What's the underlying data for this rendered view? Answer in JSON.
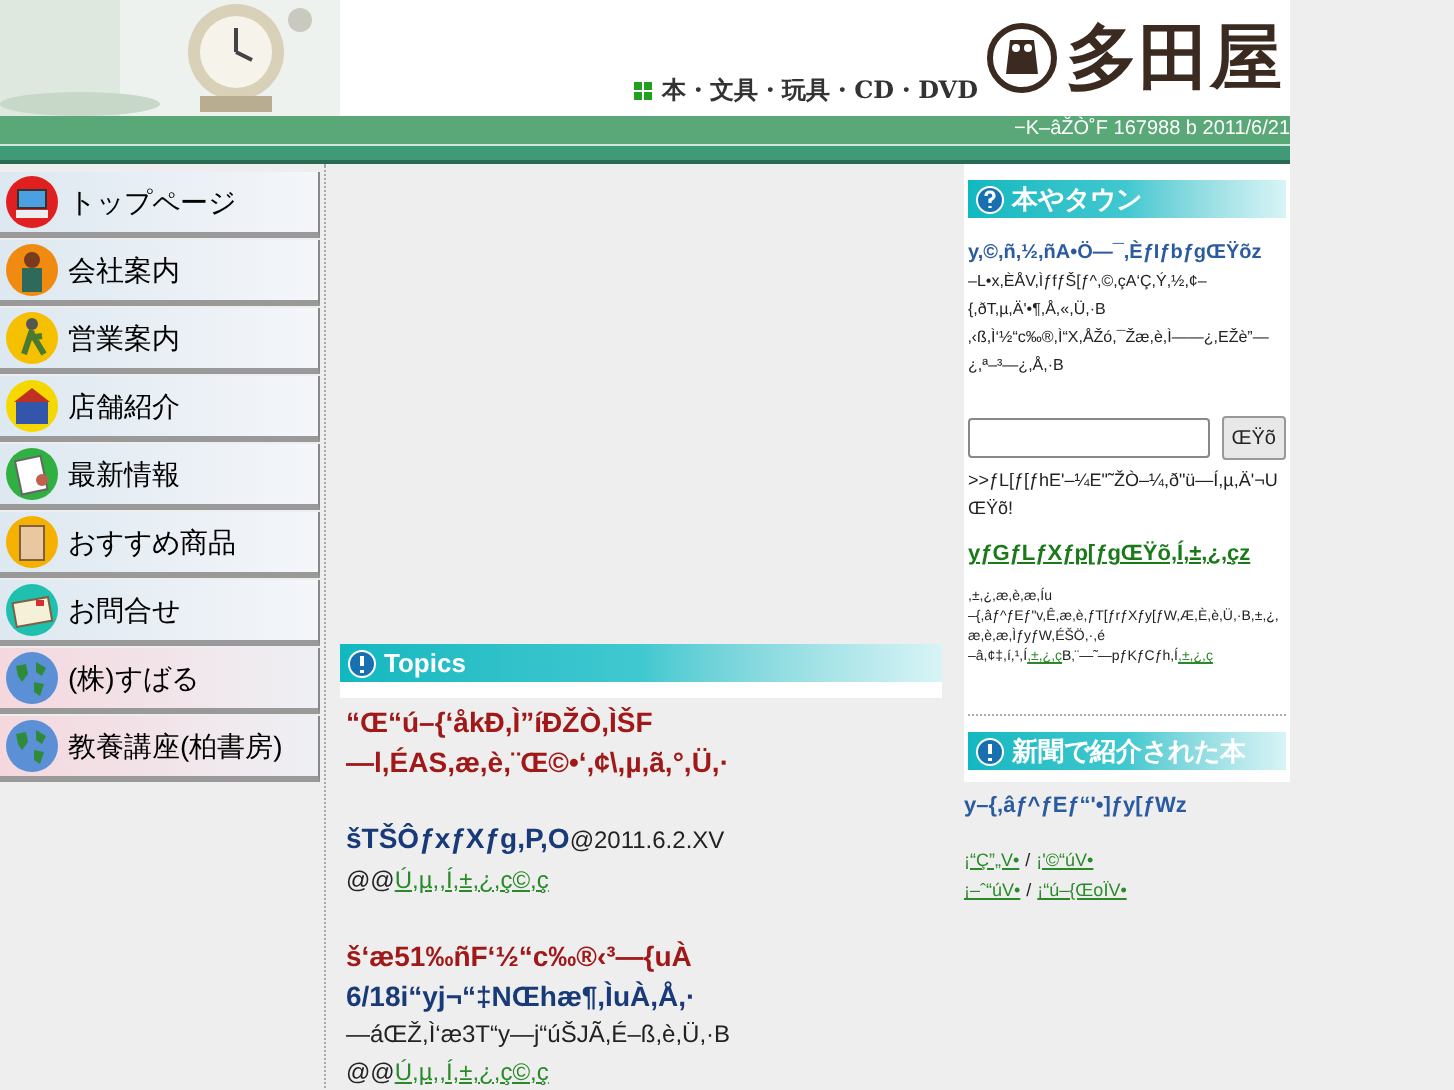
{
  "header": {
    "tagline": "本・文具・玩具・CD・DVD",
    "logo_text": "多田屋",
    "counter": "−K–âŽÒ˚F 167988 b 2011/6/21"
  },
  "nav": [
    {
      "label": "トップページ",
      "kind": "page"
    },
    {
      "label": "会社案内",
      "kind": "page"
    },
    {
      "label": "営業案内",
      "kind": "page"
    },
    {
      "label": "店舗紹介",
      "kind": "page"
    },
    {
      "label": "最新情報",
      "kind": "page"
    },
    {
      "label": "おすすめ商品",
      "kind": "page"
    },
    {
      "label": "お問合せ",
      "kind": "page"
    },
    {
      "label": "(株)すばる",
      "kind": "external"
    },
    {
      "label": "教養講座(柏書房)",
      "kind": "external"
    }
  ],
  "topics": {
    "title": "Topics",
    "items": [
      {
        "headline": "“Œ“ú–{‘åkÐ,Ì”íÐŽÒ,ÌŠF\n—l,ÉAS,æ,è,¨Œ©•‘,¢\\,µ,ã,°,Ü,·"
      },
      {
        "mark": "š",
        "title": "TŠÔƒxƒXƒg,P,O",
        "date": "@2011.6.2.XV",
        "indent": "@@",
        "link": "Ú,µ,,Í,±,¿,ç©,ç"
      },
      {
        "mark": "š",
        "title": "‘æ51‰ñF‘½“c‰®‹³—{uÀ",
        "subtitle": "6/18i“yj¬“‡NŒhæ¶,ÌuÀ,Å,·",
        "body": "—áŒŽ,Ì‘æ3T“y—j“úŠJÃ,É–ß,è,Ü,·B",
        "indent": "@@",
        "link": "Ú,µ,,Í,±,¿,ç©,ç"
      }
    ]
  },
  "hontown": {
    "title": "本やタウン",
    "heading": "y,©,ñ,½,ñA•Ö—¯,ÈƒIƒbƒgŒŸõz",
    "desc": "–L•x,ÈÅV,ÌƒfƒŠ[ƒ^,©,çA‘Ç,Ý,½,¢–{,ðT,µ,Ä'•¶,Å,«,Ü,·B\n‚‹ß,Ì‘½“c‰®,Ì“X,ÅŽó,¯Žæ,è,Ì——¿,EŽè”—¿,ª–³—¿,Å,·B",
    "search_button": "ŒŸõ",
    "hint": ">>ƒL[ƒ[ƒhE'–¼E\"˜ŽÒ–¼,ð\"ü—Í,µ,Ä'¬UŒŸõ!",
    "expert_link": "yƒGƒLƒXƒp[ƒgŒŸõ,Í,±,¿,çz",
    "note_title": ",±,¿,æ,è,æ,Íu",
    "note": "–{,âƒ^ƒEƒ\"v,Ê,æ,è,ƒT[ƒrƒXƒy[ƒW,Æ,È,è,Ü,·B,±,¿,æ,è,æ,ÌƒyƒW,ÉŠÖ,·,é",
    "contact_text": "–â,¢‡,í,¹,Í",
    "contact_link": ",±,¿,ç",
    "guide_text": "B‚¨—˜—pƒKƒCƒh,Í",
    "guide_link": ",±,¿,ç"
  },
  "news": {
    "title": "新聞で紹介された本",
    "heading": "y–{,âƒ^ƒEƒ“'•]ƒy[ƒWz",
    "links": [
      {
        "left": "¡“Ç”„V•",
        "separator": "/",
        "right": "¡'©“úV•"
      },
      {
        "left": "¡–ˆ“úV•",
        "separator": "/",
        "right": "¡“ú–{ŒoÏV•"
      }
    ]
  }
}
